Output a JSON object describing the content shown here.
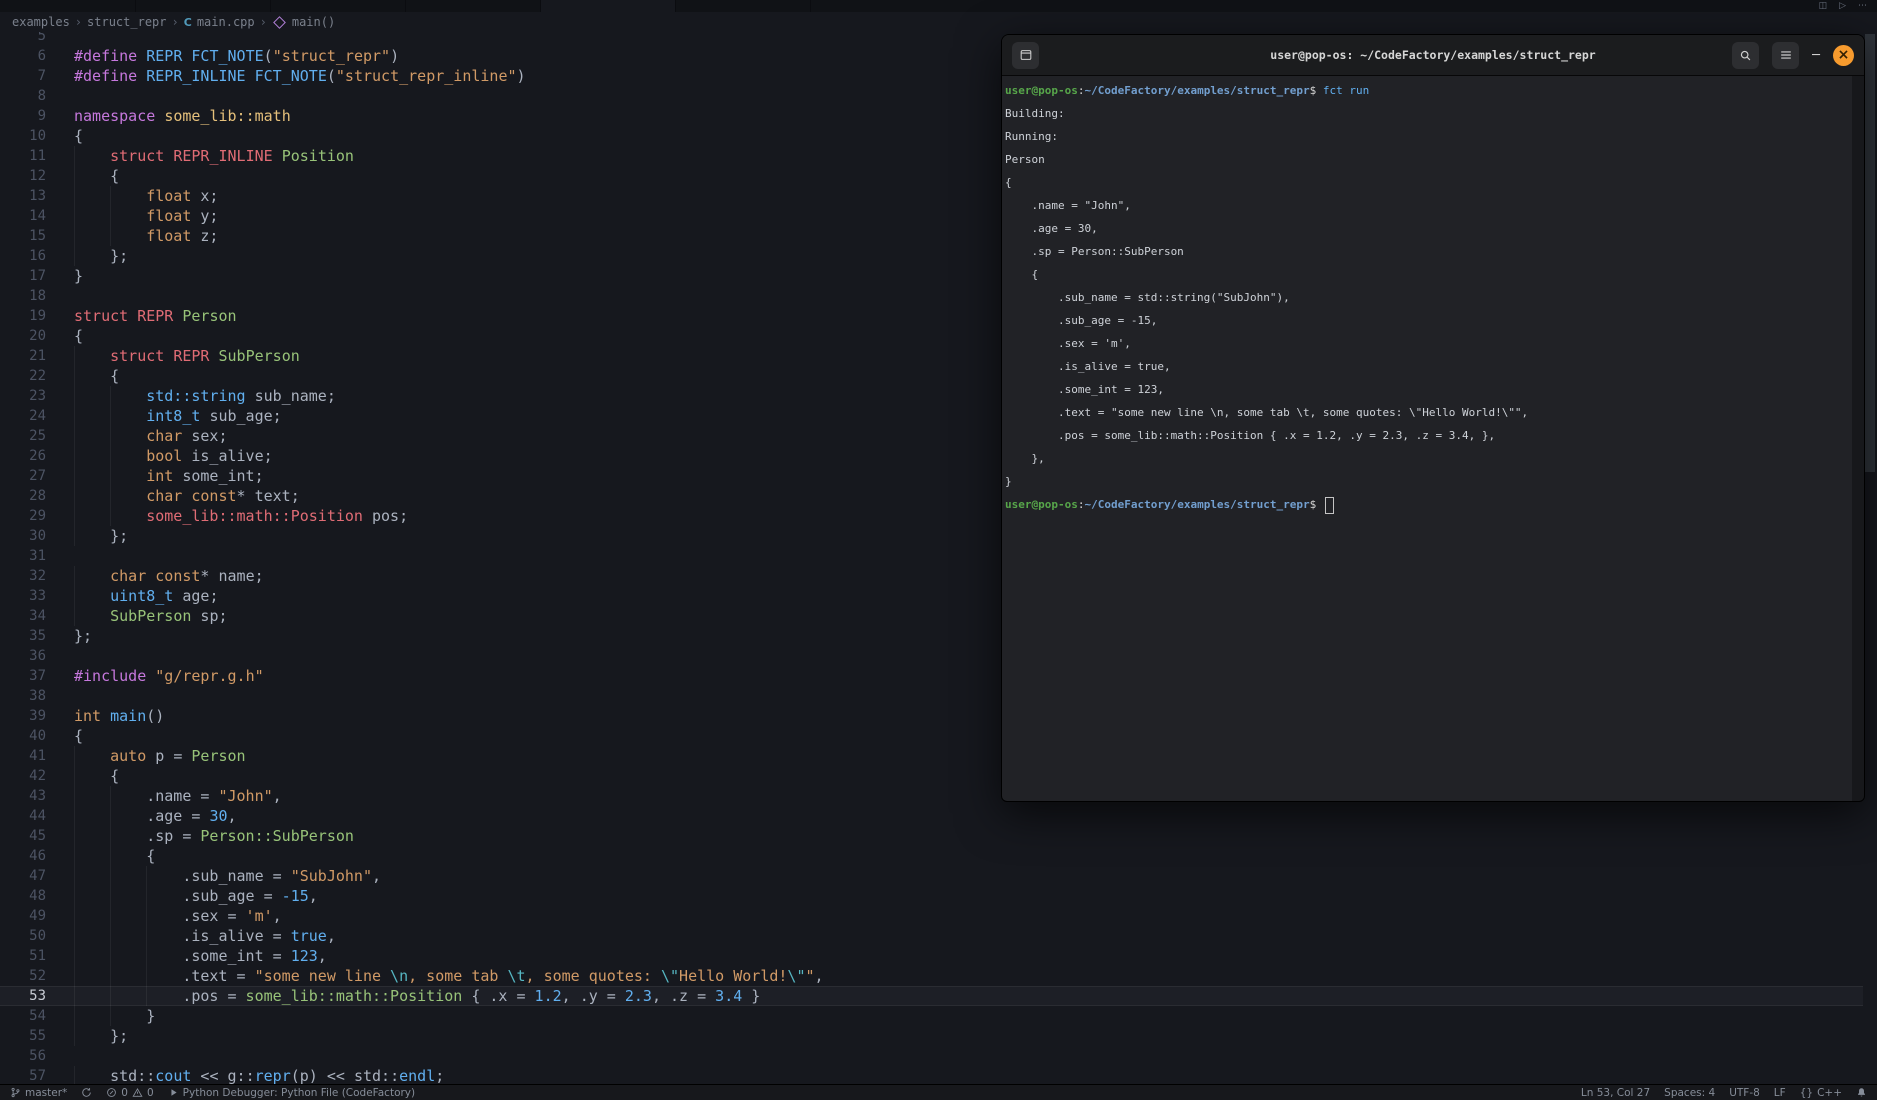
{
  "colors": {
    "accent": "#61afef",
    "close": "#f79b2e",
    "tgreen": "#57a64a",
    "tblue": "#729fcf",
    "purple": "#c678dd",
    "red": "#e06c75",
    "orange": "#d19a66",
    "green": "#98c379",
    "blue": "#61afef",
    "cyan": "#56b6c2",
    "yellow": "#e5c07b",
    "fg": "#abb2bf"
  },
  "icons": {
    "chevron": "›",
    "cpp": "C",
    "minimize": "─",
    "close": "×",
    "split": "◫",
    "run": "▷",
    "more": "⋯"
  },
  "breadcrumb": {
    "items": [
      "examples",
      "struct_repr",
      "main.cpp",
      "main()"
    ]
  },
  "editor": {
    "current_line": 53,
    "lines": [
      {
        "n": 5,
        "t": []
      },
      {
        "n": 6,
        "t": [
          [
            "pp",
            "#define "
          ],
          [
            "blu",
            "REPR "
          ],
          [
            "blu",
            "FCT_NOTE"
          ],
          [
            "pl",
            "("
          ],
          [
            "str",
            "\"struct_repr\""
          ],
          [
            "pl",
            ")"
          ]
        ]
      },
      {
        "n": 7,
        "t": [
          [
            "pp",
            "#define "
          ],
          [
            "blu",
            "REPR_INLINE "
          ],
          [
            "blu",
            "FCT_NOTE"
          ],
          [
            "pl",
            "("
          ],
          [
            "str",
            "\"struct_repr_inline\""
          ],
          [
            "pl",
            ")"
          ]
        ]
      },
      {
        "n": 8,
        "t": []
      },
      {
        "n": 9,
        "t": [
          [
            "pp",
            "namespace "
          ],
          [
            "ylw",
            "some_lib::math"
          ]
        ]
      },
      {
        "n": 10,
        "t": [
          [
            "pl",
            "{"
          ]
        ]
      },
      {
        "n": 11,
        "t": [
          [
            "pl",
            "    "
          ],
          [
            "red",
            "struct REPR_INLINE "
          ],
          [
            "typ",
            "Position"
          ]
        ]
      },
      {
        "n": 12,
        "t": [
          [
            "pl",
            "    {"
          ]
        ]
      },
      {
        "n": 13,
        "t": [
          [
            "pl",
            "        "
          ],
          [
            "orn",
            "float "
          ],
          [
            "pl",
            "x;"
          ]
        ]
      },
      {
        "n": 14,
        "t": [
          [
            "pl",
            "        "
          ],
          [
            "orn",
            "float "
          ],
          [
            "pl",
            "y;"
          ]
        ]
      },
      {
        "n": 15,
        "t": [
          [
            "pl",
            "        "
          ],
          [
            "orn",
            "float "
          ],
          [
            "pl",
            "z;"
          ]
        ]
      },
      {
        "n": 16,
        "t": [
          [
            "pl",
            "    };"
          ]
        ]
      },
      {
        "n": 17,
        "t": [
          [
            "pl",
            "}"
          ]
        ]
      },
      {
        "n": 18,
        "t": []
      },
      {
        "n": 19,
        "t": [
          [
            "red",
            "struct REPR "
          ],
          [
            "typ",
            "Person"
          ]
        ]
      },
      {
        "n": 20,
        "t": [
          [
            "pl",
            "{"
          ]
        ]
      },
      {
        "n": 21,
        "t": [
          [
            "pl",
            "    "
          ],
          [
            "red",
            "struct REPR "
          ],
          [
            "typ",
            "SubPerson"
          ]
        ]
      },
      {
        "n": 22,
        "t": [
          [
            "pl",
            "    {"
          ]
        ]
      },
      {
        "n": 23,
        "t": [
          [
            "pl",
            "        "
          ],
          [
            "blu",
            "std::string "
          ],
          [
            "pl",
            "sub_name;"
          ]
        ]
      },
      {
        "n": 24,
        "t": [
          [
            "pl",
            "        "
          ],
          [
            "blu",
            "int8_t "
          ],
          [
            "pl",
            "sub_age;"
          ]
        ]
      },
      {
        "n": 25,
        "t": [
          [
            "pl",
            "        "
          ],
          [
            "orn",
            "char "
          ],
          [
            "pl",
            "sex;"
          ]
        ]
      },
      {
        "n": 26,
        "t": [
          [
            "pl",
            "        "
          ],
          [
            "orn",
            "bool "
          ],
          [
            "pl",
            "is_alive;"
          ]
        ]
      },
      {
        "n": 27,
        "t": [
          [
            "pl",
            "        "
          ],
          [
            "orn",
            "int "
          ],
          [
            "pl",
            "some_int;"
          ]
        ]
      },
      {
        "n": 28,
        "t": [
          [
            "pl",
            "        "
          ],
          [
            "orn",
            "char const"
          ],
          [
            "pl",
            "* text;"
          ]
        ]
      },
      {
        "n": 29,
        "t": [
          [
            "pl",
            "        "
          ],
          [
            "red",
            "some_lib::math::Position "
          ],
          [
            "pl",
            "pos;"
          ]
        ]
      },
      {
        "n": 30,
        "t": [
          [
            "pl",
            "    };"
          ]
        ]
      },
      {
        "n": 31,
        "t": []
      },
      {
        "n": 32,
        "t": [
          [
            "pl",
            "    "
          ],
          [
            "orn",
            "char const"
          ],
          [
            "pl",
            "* name;"
          ]
        ]
      },
      {
        "n": 33,
        "t": [
          [
            "pl",
            "    "
          ],
          [
            "blu",
            "uint8_t "
          ],
          [
            "pl",
            "age;"
          ]
        ]
      },
      {
        "n": 34,
        "t": [
          [
            "pl",
            "    "
          ],
          [
            "typ",
            "SubPerson "
          ],
          [
            "pl",
            "sp;"
          ]
        ]
      },
      {
        "n": 35,
        "t": [
          [
            "pl",
            "};"
          ]
        ]
      },
      {
        "n": 36,
        "t": []
      },
      {
        "n": 37,
        "t": [
          [
            "pp",
            "#include "
          ],
          [
            "str",
            "\"g/repr.g.h\""
          ]
        ]
      },
      {
        "n": 38,
        "t": []
      },
      {
        "n": 39,
        "t": [
          [
            "orn",
            "int "
          ],
          [
            "blu",
            "main"
          ],
          [
            "pl",
            "()"
          ]
        ]
      },
      {
        "n": 40,
        "t": [
          [
            "pl",
            "{"
          ]
        ]
      },
      {
        "n": 41,
        "t": [
          [
            "pl",
            "    "
          ],
          [
            "orn",
            "auto "
          ],
          [
            "pl",
            "p = "
          ],
          [
            "typ",
            "Person"
          ]
        ]
      },
      {
        "n": 42,
        "t": [
          [
            "pl",
            "    {"
          ]
        ]
      },
      {
        "n": 43,
        "t": [
          [
            "pl",
            "        .name = "
          ],
          [
            "str",
            "\"John\""
          ],
          [
            "pl",
            ","
          ]
        ]
      },
      {
        "n": 44,
        "t": [
          [
            "pl",
            "        .age = "
          ],
          [
            "num",
            "30"
          ],
          [
            "pl",
            ","
          ]
        ]
      },
      {
        "n": 45,
        "t": [
          [
            "pl",
            "        .sp = "
          ],
          [
            "typ",
            "Person::SubPerson"
          ]
        ]
      },
      {
        "n": 46,
        "t": [
          [
            "pl",
            "        {"
          ]
        ]
      },
      {
        "n": 47,
        "t": [
          [
            "pl",
            "            .sub_name = "
          ],
          [
            "str",
            "\"SubJohn\""
          ],
          [
            "pl",
            ","
          ]
        ]
      },
      {
        "n": 48,
        "t": [
          [
            "pl",
            "            .sub_age = "
          ],
          [
            "num",
            "-15"
          ],
          [
            "pl",
            ","
          ]
        ]
      },
      {
        "n": 49,
        "t": [
          [
            "pl",
            "            .sex = "
          ],
          [
            "str",
            "'m'"
          ],
          [
            "pl",
            ","
          ]
        ]
      },
      {
        "n": 50,
        "t": [
          [
            "pl",
            "            .is_alive = "
          ],
          [
            "num",
            "true"
          ],
          [
            "pl",
            ","
          ]
        ]
      },
      {
        "n": 51,
        "t": [
          [
            "pl",
            "            .some_int = "
          ],
          [
            "num",
            "123"
          ],
          [
            "pl",
            ","
          ]
        ]
      },
      {
        "n": 52,
        "t": [
          [
            "pl",
            "            .text = "
          ],
          [
            "str",
            "\"some new line "
          ],
          [
            "esc",
            "\\n"
          ],
          [
            "str",
            ", some tab "
          ],
          [
            "esc",
            "\\t"
          ],
          [
            "str",
            ", some quotes: "
          ],
          [
            "esc",
            "\\\""
          ],
          [
            "str",
            "Hello World!"
          ],
          [
            "esc",
            "\\\""
          ],
          [
            "str",
            "\""
          ],
          [
            "pl",
            ","
          ]
        ]
      },
      {
        "n": 53,
        "t": [
          [
            "pl",
            "            .pos = "
          ],
          [
            "typ",
            "some_lib::math::Position"
          ],
          [
            "pl",
            " { .x = "
          ],
          [
            "num",
            "1.2"
          ],
          [
            "pl",
            ", .y = "
          ],
          [
            "num",
            "2.3"
          ],
          [
            "pl",
            ", .z = "
          ],
          [
            "num",
            "3.4"
          ],
          [
            "pl",
            " }"
          ]
        ]
      },
      {
        "n": 54,
        "t": [
          [
            "pl",
            "        }"
          ]
        ]
      },
      {
        "n": 55,
        "t": [
          [
            "pl",
            "    };"
          ]
        ]
      },
      {
        "n": 56,
        "t": []
      },
      {
        "n": 57,
        "t": [
          [
            "pl",
            "    std::"
          ],
          [
            "blu",
            "cout"
          ],
          [
            "pl",
            " << g::"
          ],
          [
            "blu",
            "repr"
          ],
          [
            "pl",
            "(p) << std::"
          ],
          [
            "blu",
            "endl"
          ],
          [
            "pl",
            ";"
          ]
        ]
      }
    ]
  },
  "terminal": {
    "title": "user@pop-os: ~/CodeFactory/examples/struct_repr",
    "lines": [
      {
        "s": [
          [
            "g",
            "user@pop-os"
          ],
          [
            "w",
            ":"
          ],
          [
            "b",
            "~/CodeFactory/examples/struct_repr"
          ],
          [
            "w",
            "$ "
          ],
          [
            "c",
            "fct run"
          ]
        ]
      },
      {
        "s": [
          [
            "o",
            "Building:"
          ]
        ]
      },
      {
        "s": [
          [
            "o",
            "Running:"
          ]
        ]
      },
      {
        "s": [
          [
            "o",
            "Person"
          ]
        ]
      },
      {
        "s": [
          [
            "o",
            "{"
          ]
        ]
      },
      {
        "s": [
          [
            "o",
            "    .name = \"John\","
          ]
        ]
      },
      {
        "s": [
          [
            "o",
            "    .age = 30,"
          ]
        ]
      },
      {
        "s": [
          [
            "o",
            "    .sp = Person::SubPerson"
          ]
        ]
      },
      {
        "s": [
          [
            "o",
            "    {"
          ]
        ]
      },
      {
        "s": [
          [
            "o",
            "        .sub_name = std::string(\"SubJohn\"),"
          ]
        ]
      },
      {
        "s": [
          [
            "o",
            "        .sub_age = -15,"
          ]
        ]
      },
      {
        "s": [
          [
            "o",
            "        .sex = 'm',"
          ]
        ]
      },
      {
        "s": [
          [
            "o",
            "        .is_alive = true,"
          ]
        ]
      },
      {
        "s": [
          [
            "o",
            "        .some_int = 123,"
          ]
        ]
      },
      {
        "s": [
          [
            "o",
            "        .text = \"some new line \\n, some tab \\t, some quotes: \\\"Hello World!\\\"\","
          ]
        ]
      },
      {
        "s": [
          [
            "o",
            "        .pos = some_lib::math::Position { .x = 1.2, .y = 2.3, .z = 3.4, },"
          ]
        ]
      },
      {
        "s": [
          [
            "o",
            "    },"
          ]
        ]
      },
      {
        "s": [
          [
            "o",
            "}"
          ]
        ]
      },
      {
        "s": [
          [
            "g",
            "user@pop-os"
          ],
          [
            "w",
            ":"
          ],
          [
            "b",
            "~/CodeFactory/examples/struct_repr"
          ],
          [
            "w",
            "$ "
          ]
        ],
        "cursor": true
      }
    ]
  },
  "statusbar": {
    "branch": "master*",
    "errors": "0",
    "warnings": "0",
    "debugger": "Python Debugger: Python File (CodeFactory)",
    "line_col": "Ln 53, Col 27",
    "indent": "Spaces: 4",
    "encoding": "UTF-8",
    "eol": "LF",
    "braces_icon": "{}",
    "language": "C++"
  }
}
